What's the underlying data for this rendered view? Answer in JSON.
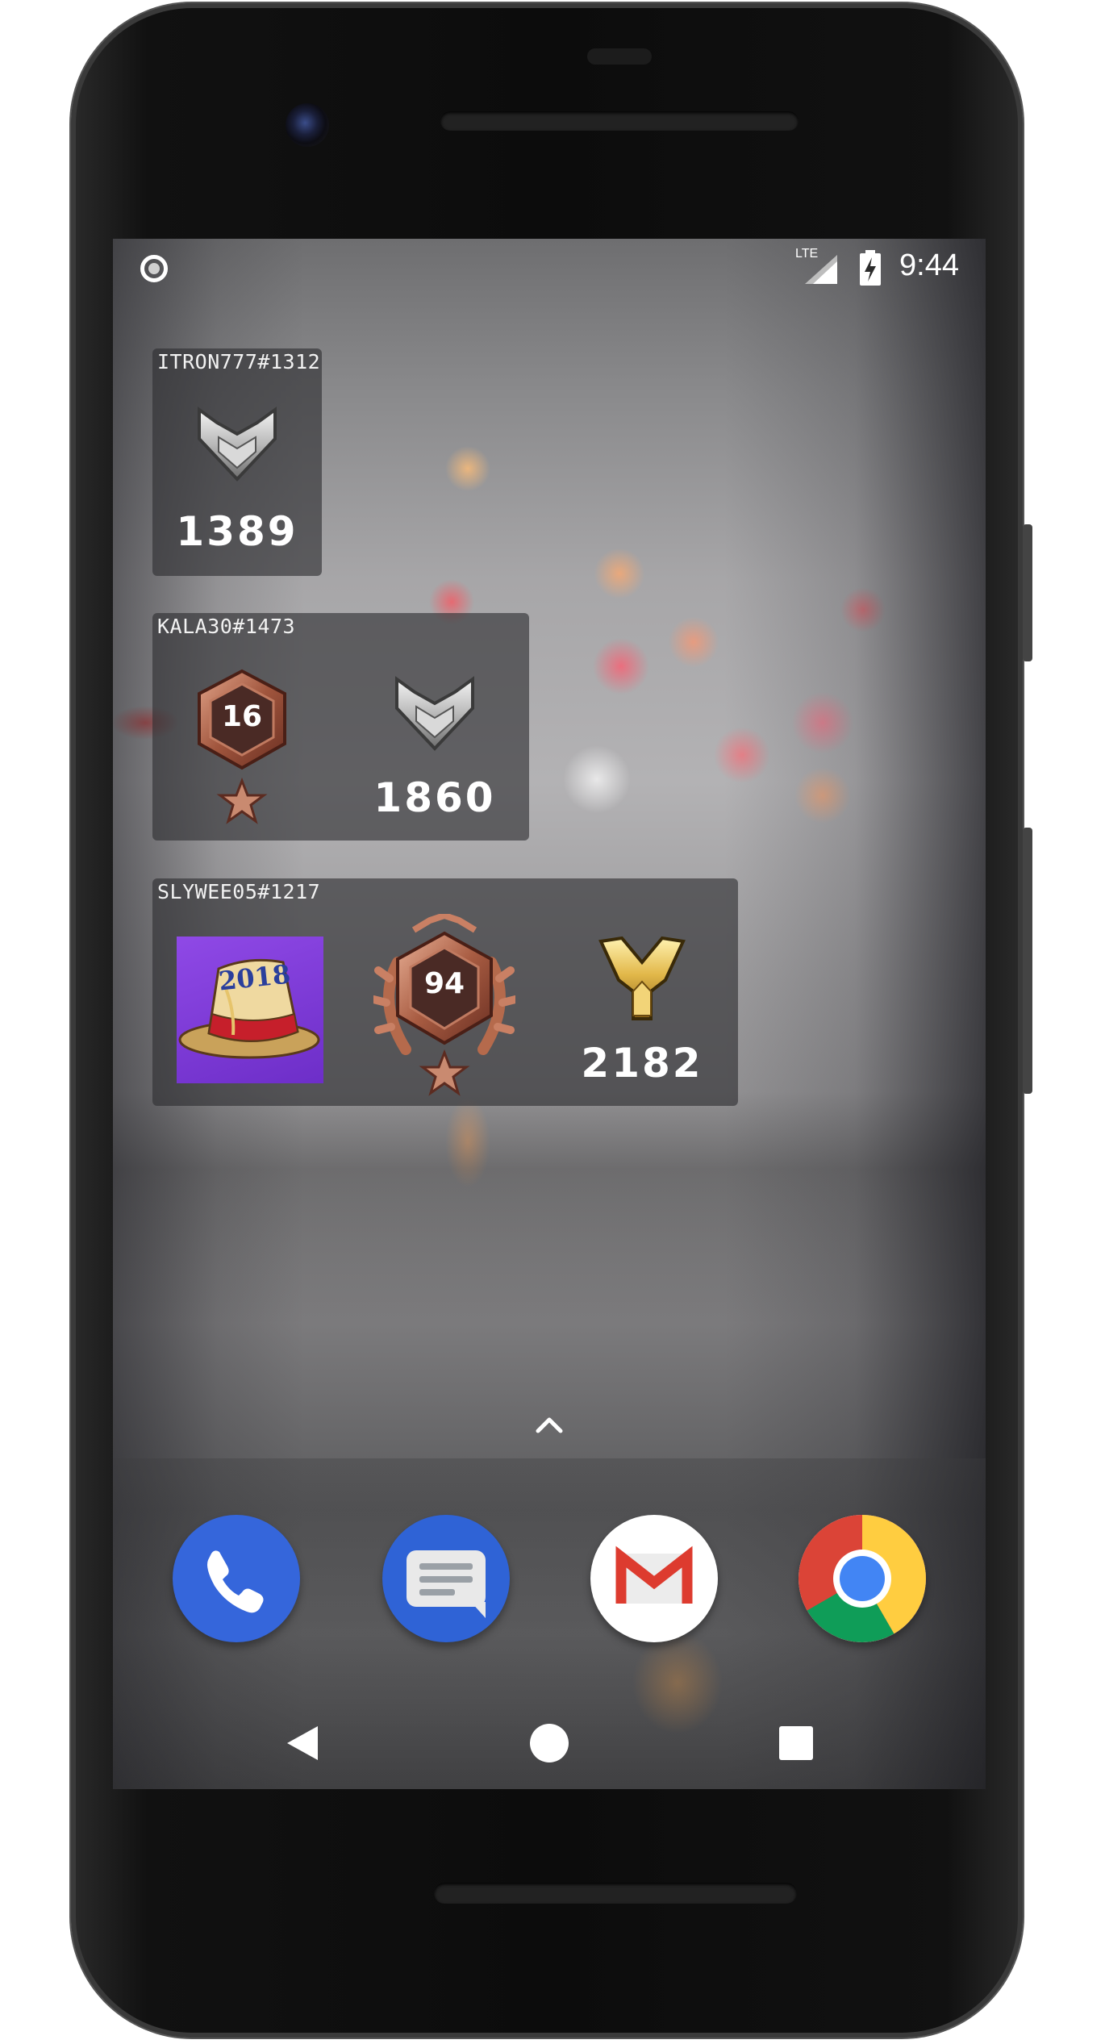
{
  "status_bar": {
    "network_label": "LTE",
    "time": "9:44",
    "icons": [
      "notification-dot-icon",
      "signal-icon",
      "battery-charging-icon"
    ]
  },
  "widgets": [
    {
      "player": "ITRON777#1312",
      "skill_rating": "1389",
      "rank_icon": "silver-rank-icon"
    },
    {
      "player": "KALA30#1473",
      "level": "16",
      "skill_rating": "1860",
      "level_icon": "bronze-level-badge-icon",
      "rank_icon": "silver-rank-icon"
    },
    {
      "player": "SLYWEE05#1217",
      "portrait_text": "2018",
      "level": "94",
      "skill_rating": "2182",
      "portrait_icon": "2018-party-hat-portrait",
      "level_icon": "bronze-laurel-level-badge-icon",
      "rank_icon": "gold-rank-icon"
    }
  ],
  "dock": {
    "apps": [
      {
        "name": "Phone",
        "icon": "phone-icon",
        "color": "#3b6fe0"
      },
      {
        "name": "Messages",
        "icon": "messages-icon",
        "color": "#2f63d6"
      },
      {
        "name": "Gmail",
        "icon": "gmail-icon",
        "color": "#ea4335"
      },
      {
        "name": "Chrome",
        "icon": "chrome-icon",
        "color": "#4285f4"
      }
    ]
  },
  "nav_bar": {
    "buttons": [
      "back-icon",
      "home-icon",
      "recents-icon"
    ]
  }
}
